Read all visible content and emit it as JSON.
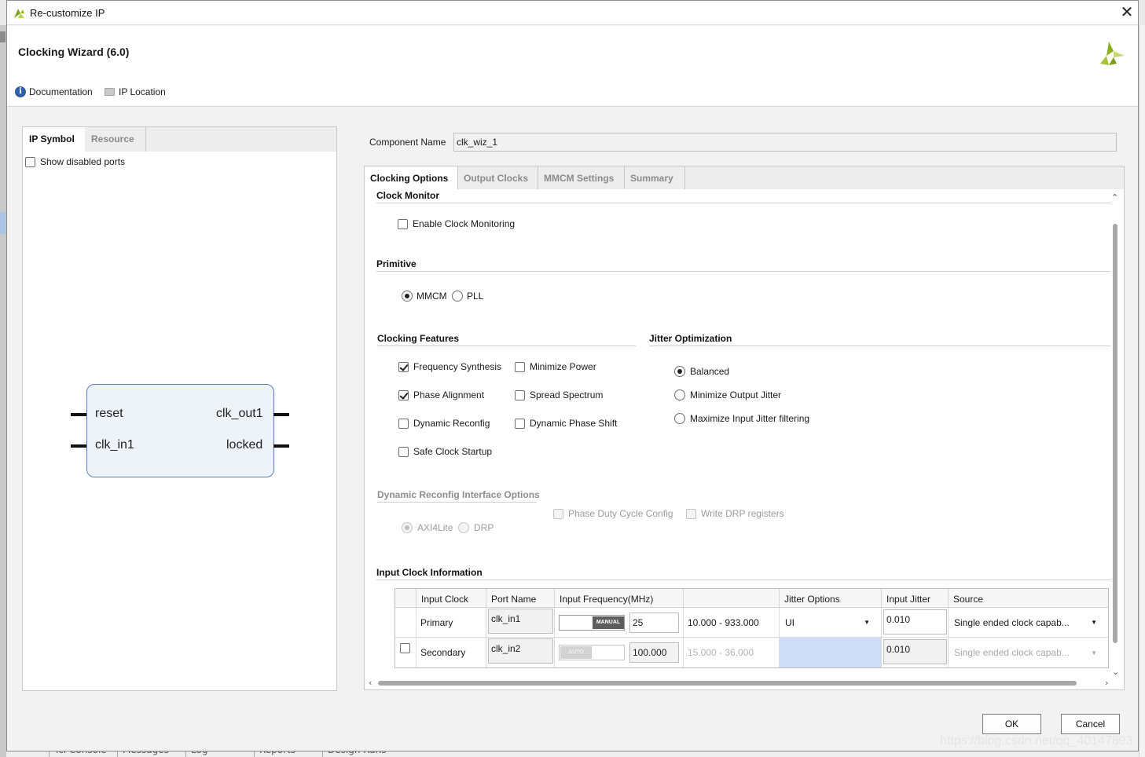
{
  "window": {
    "title": "Re-customize IP",
    "close_glyph": "✕"
  },
  "header": {
    "wizard_title": "Clocking Wizard (6.0)",
    "doc_link": "Documentation",
    "ip_location_link": "IP Location",
    "logo_icon": "xilinx-logo-icon",
    "accent_color": "#9bbb28"
  },
  "left_panel": {
    "tabs": [
      {
        "label": "IP Symbol",
        "active": true
      },
      {
        "label": "Resource",
        "active": false
      }
    ],
    "show_disabled_ports": {
      "label": "Show disabled ports",
      "checked": false
    },
    "symbol": {
      "inputs": [
        "reset",
        "clk_in1"
      ],
      "outputs": [
        "clk_out1",
        "locked"
      ]
    }
  },
  "component": {
    "label": "Component Name",
    "value": "clk_wiz_1"
  },
  "main_tabs": [
    {
      "label": "Clocking Options",
      "active": true
    },
    {
      "label": "Output Clocks",
      "active": false
    },
    {
      "label": "MMCM Settings",
      "active": false
    },
    {
      "label": "Summary",
      "active": false
    }
  ],
  "clock_monitor": {
    "title": "Clock Monitor",
    "enable": {
      "label": "Enable Clock Monitoring",
      "checked": false
    }
  },
  "primitive": {
    "title": "Primitive",
    "options": [
      {
        "label": "MMCM",
        "selected": true
      },
      {
        "label": "PLL",
        "selected": false
      }
    ]
  },
  "clocking_features": {
    "title": "Clocking Features",
    "frequency_synthesis": {
      "label": "Frequency Synthesis",
      "checked": true
    },
    "minimize_power": {
      "label": "Minimize Power",
      "checked": false
    },
    "phase_alignment": {
      "label": "Phase Alignment",
      "checked": true
    },
    "spread_spectrum": {
      "label": "Spread Spectrum",
      "checked": false
    },
    "dynamic_reconfig": {
      "label": "Dynamic Reconfig",
      "checked": false
    },
    "dynamic_phase_shift": {
      "label": "Dynamic Phase Shift",
      "checked": false
    },
    "safe_clock_startup": {
      "label": "Safe Clock Startup",
      "checked": false
    }
  },
  "jitter_optimization": {
    "title": "Jitter Optimization",
    "options": [
      {
        "label": "Balanced",
        "selected": true
      },
      {
        "label": "Minimize Output Jitter",
        "selected": false
      },
      {
        "label": "Maximize Input Jitter filtering",
        "selected": false
      }
    ]
  },
  "drp_options": {
    "title": "Dynamic Reconfig Interface Options",
    "axi4lite": {
      "label": "AXI4Lite",
      "selected": true
    },
    "drp": {
      "label": "DRP",
      "selected": false
    },
    "phase_duty": {
      "label": "Phase Duty Cycle Config",
      "checked": false
    },
    "write_drp": {
      "label": "Write DRP registers",
      "checked": false
    }
  },
  "input_clock_info": {
    "title": "Input Clock Information",
    "columns": [
      "Input Clock",
      "Port Name",
      "Input Frequency(MHz)",
      "",
      "Jitter Options",
      "Input Jitter",
      "Source"
    ],
    "rows": [
      {
        "input_clock": "Primary",
        "port_name": "clk_in1",
        "mode": "MANUAL",
        "frequency": "25",
        "range": "10.000 - 933.000",
        "jitter_option": "UI",
        "input_jitter": "0.010",
        "source": "Single ended clock capab..."
      },
      {
        "input_clock": "Secondary",
        "port_name": "clk_in2",
        "mode": "AUTO",
        "frequency": "100.000",
        "range": "15.000 - 36.000",
        "jitter_option": "",
        "input_jitter": "0.010",
        "source": "Single ended clock capab..."
      }
    ]
  },
  "buttons": {
    "ok": "OK",
    "cancel": "Cancel"
  },
  "background_tabs": [
    "Tcl Console",
    "Messages",
    "Log",
    "Reports",
    "Design Runs"
  ],
  "watermark": "https://blog.csdn.net/qq_40147893"
}
